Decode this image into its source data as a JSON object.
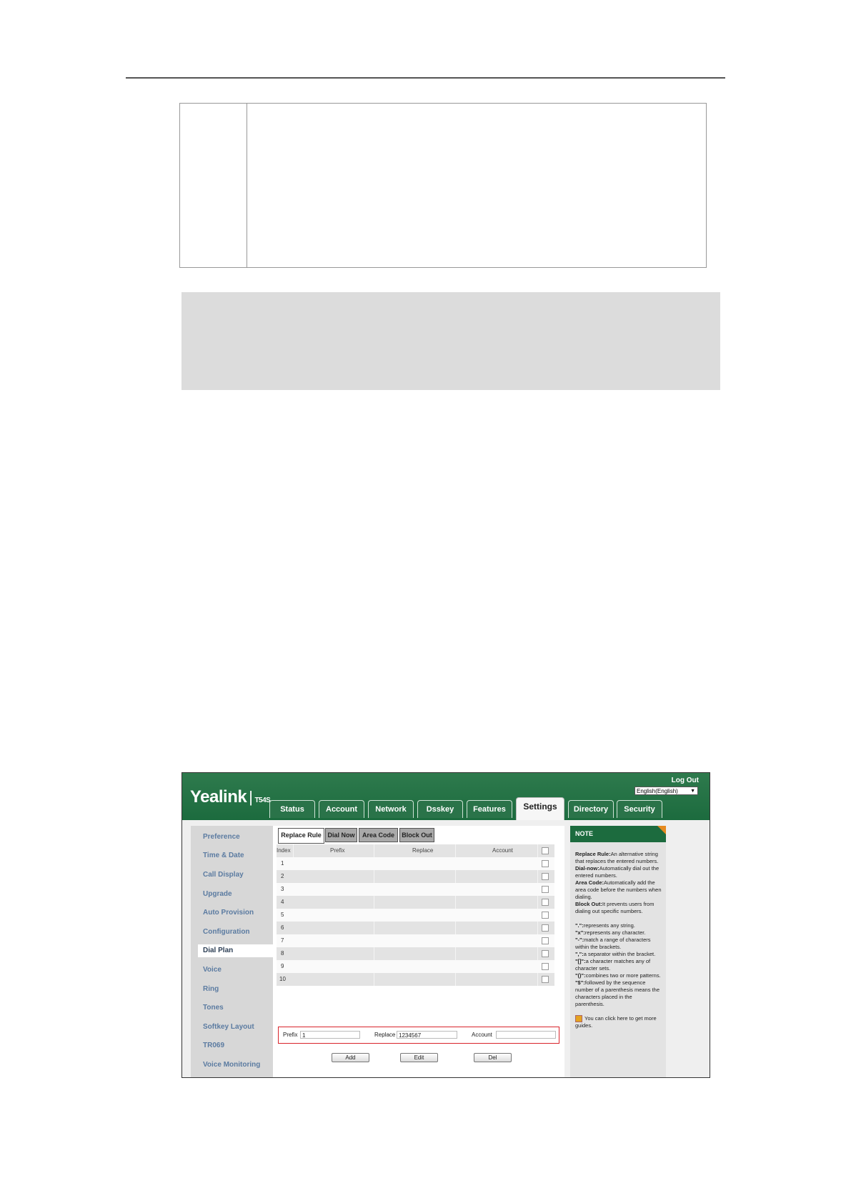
{
  "screenshot": {
    "brand": "Yealink",
    "model": "T54S",
    "logout": "Log Out",
    "language": "English(English)",
    "main_tabs": [
      "Status",
      "Account",
      "Network",
      "Dsskey",
      "Features",
      "Settings",
      "Directory",
      "Security"
    ],
    "active_tab": "Settings",
    "sidebar": [
      "Preference",
      "Time & Date",
      "Call Display",
      "Upgrade",
      "Auto Provision",
      "Configuration",
      "Dial Plan",
      "Voice",
      "Ring",
      "Tones",
      "Softkey Layout",
      "TR069",
      "Voice Monitoring"
    ],
    "active_sidebar": "Dial Plan",
    "sub_tabs": [
      "Replace Rule",
      "Dial Now",
      "Area Code",
      "Block Out"
    ],
    "active_sub_tab": "Replace Rule",
    "table": {
      "headers": [
        "Index",
        "Prefix",
        "Replace",
        "Account"
      ],
      "rows": [
        "1",
        "2",
        "3",
        "4",
        "5",
        "6",
        "7",
        "8",
        "9",
        "10"
      ]
    },
    "inputs": {
      "prefix_label": "Prefix",
      "prefix_value": "1",
      "replace_label": "Replace",
      "replace_value": "1234567",
      "account_label": "Account",
      "account_value": ""
    },
    "buttons": {
      "add": "Add",
      "edit": "Edit",
      "del": "Del"
    },
    "note": {
      "title": "NOTE",
      "items": [
        {
          "term": "Replace Rule:",
          "text": "An alternative string that replaces the entered numbers."
        },
        {
          "term": "Dial-now:",
          "text": "Automatically dial out the entered numbers."
        },
        {
          "term": "Area Code:",
          "text": "Automatically add the area code before the numbers when dialing."
        },
        {
          "term": "Block Out:",
          "text": "It prevents users from dialing out specific numbers."
        }
      ],
      "patterns": [
        {
          "term": "\".\":",
          "text": "represents any string."
        },
        {
          "term": "\"x\":",
          "text": "represents any character."
        },
        {
          "term": "\"-\":",
          "text": "match a range of characters within the brackets."
        },
        {
          "term": "\",\":",
          "text": "a separator within the bracket."
        },
        {
          "term": "\"[]\":",
          "text": "a character matches any of character sets."
        },
        {
          "term": "\"()\":",
          "text": "combines two or more patterns."
        },
        {
          "term": "\"$\":",
          "text": "followed by the sequence number of a parenthesis means the characters placed in the parenthesis."
        }
      ],
      "tip": "You can click here to get more guides."
    }
  }
}
